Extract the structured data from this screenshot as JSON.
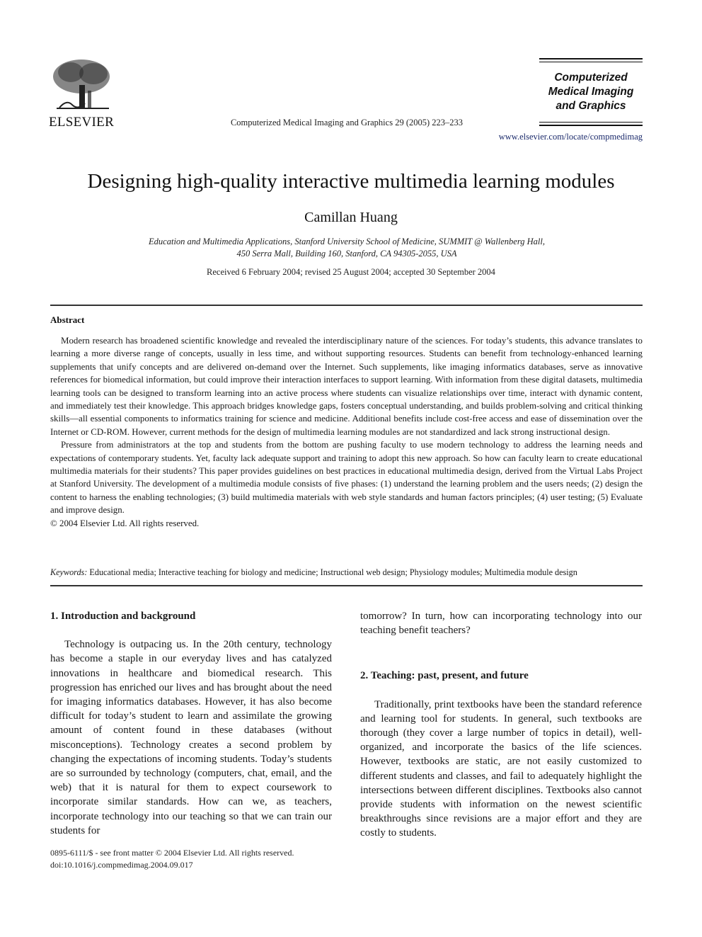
{
  "header": {
    "publisher_logo_text": "ELSEVIER",
    "citation": "Computerized Medical Imaging and Graphics 29 (2005) 223–233",
    "journal_name_lines": [
      "Computerized",
      "Medical Imaging",
      "and Graphics"
    ],
    "journal_url": "www.elsevier.com/locate/compmedimag"
  },
  "article": {
    "title": "Designing high-quality interactive multimedia learning modules",
    "author": "Camillan Huang",
    "affiliation_lines": [
      "Education and Multimedia Applications, Stanford University School of Medicine, SUMMIT @ Wallenberg Hall,",
      "450 Serra Mall, Building 160, Stanford, CA 94305-2055, USA"
    ],
    "dates": "Received 6 February 2004; revised 25 August 2004; accepted 30 September 2004"
  },
  "abstract": {
    "heading": "Abstract",
    "paragraphs": [
      "Modern research has broadened scientific knowledge and revealed the interdisciplinary nature of the sciences. For today’s students, this advance translates to learning a more diverse range of concepts, usually in less time, and without supporting resources. Students can benefit from technology-enhanced learning supplements that unify concepts and are delivered on-demand over the Internet. Such supplements, like imaging informatics databases, serve as innovative references for biomedical information, but could improve their interaction interfaces to support learning. With information from these digital datasets, multimedia learning tools can be designed to transform learning into an active process where students can visualize relationships over time, interact with dynamic content, and immediately test their knowledge. This approach bridges knowledge gaps, fosters conceptual understanding, and builds problem-solving and critical thinking skills—all essential components to informatics training for science and medicine. Additional benefits include cost-free access and ease of dissemination over the Internet or CD-ROM. However, current methods for the design of multimedia learning modules are not standardized and lack strong instructional design.",
      "Pressure from administrators at the top and students from the bottom are pushing faculty to use modern technology to address the learning needs and expectations of contemporary students. Yet, faculty lack adequate support and training to adopt this new approach. So how can faculty learn to create educational multimedia materials for their students? This paper provides guidelines on best practices in educational multimedia design, derived from the Virtual Labs Project at Stanford University. The development of a multimedia module consists of five phases: (1) understand the learning problem and the users needs; (2) design the content to harness the enabling technologies; (3) build multimedia materials with web style standards and human factors principles; (4) user testing; (5) Evaluate and improve design."
    ],
    "copyright": "© 2004 Elsevier Ltd. All rights reserved."
  },
  "keywords": {
    "label": "Keywords:",
    "text": "Educational media; Interactive teaching for biology and medicine; Instructional web design; Physiology modules; Multimedia module design"
  },
  "sections": {
    "s1": {
      "heading": "1. Introduction and background",
      "para1": "Technology is outpacing us. In the 20th century, technology has become a staple in our everyday lives and has catalyzed innovations in healthcare and biomedical research. This progression has enriched our lives and has brought about the need for imaging informatics databases. However, it has also become difficult for today’s student to learn and assimilate the growing amount of content found in these databases (without misconceptions). Technology creates a second problem by changing the expectations of incoming students. Today’s students are so surrounded by technology (computers, chat, email, and the web) that it is natural for them to expect coursework to incorporate similar standards. How can we, as teachers, incorporate technology into our teaching so that we can train our students for",
      "para1_cont": "tomorrow? In turn, how can incorporating technology into our teaching benefit teachers?"
    },
    "s2": {
      "heading": "2. Teaching: past, present, and future",
      "para1": "Traditionally, print textbooks have been the standard reference and learning tool for students. In general, such textbooks are thorough (they cover a large number of topics in detail), well-organized, and incorporate the basics of the life sciences. However, textbooks are static, are not easily customized to different students and classes, and fail to adequately highlight the intersections between different disciplines. Textbooks also cannot provide students with information on the newest scientific breakthroughs since revisions are a major effort and they are costly to students."
    }
  },
  "footer": {
    "issn_line": "0895-6111/$ - see front matter © 2004 Elsevier Ltd. All rights reserved.",
    "doi": "doi:10.1016/j.compmedimag.2004.09.017"
  },
  "colors": {
    "text": "#1a1a1a",
    "link": "#1b2a6b",
    "rule": "#333333"
  }
}
